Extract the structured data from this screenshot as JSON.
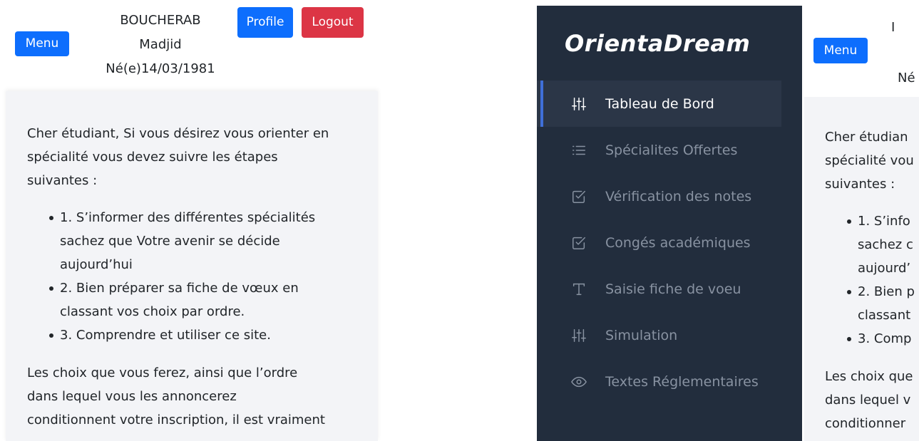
{
  "left": {
    "menu_label": "Menu",
    "profile_label": "Profile",
    "logout_label": "Logout",
    "user": {
      "last_name": "BOUCHERAB",
      "first_name": "Madjid",
      "birth": "Né(e)14/03/1981"
    },
    "intro_lines": [
      "Cher étudiant, Si vous désirez vous orienter en",
      "spécialité vous devez suivre les étapes",
      "suivantes :"
    ],
    "steps": [
      [
        "1. S’informer des différentes spécialités",
        "sachez que Votre avenir se décide",
        "aujourd’hui"
      ],
      [
        "2. Bien préparer sa fiche de vœux en",
        "classant vos choix par ordre."
      ],
      [
        "3. Comprendre et utiliser ce site."
      ]
    ],
    "closing_lines": [
      "Les choix que vous ferez, ainsi que l’ordre",
      "dans lequel vous les annoncerez",
      "conditionnent votre inscription, il est vraiment"
    ]
  },
  "right": {
    "brand": "OrientaDream",
    "nav": [
      {
        "label": "Tableau de Bord",
        "icon": "sliders-icon",
        "active": true
      },
      {
        "label": "Spécialites Offertes",
        "icon": "list-icon",
        "active": false
      },
      {
        "label": "Vérification des notes",
        "icon": "checkbox-icon",
        "active": false
      },
      {
        "label": "Congés académiques",
        "icon": "checkbox-icon",
        "active": false
      },
      {
        "label": "Saisie fiche de voeu",
        "icon": "text-icon",
        "active": false
      },
      {
        "label": "Simulation",
        "icon": "sliders-icon",
        "active": false
      },
      {
        "label": "Textes Réglementaires",
        "icon": "eye-icon",
        "active": false
      }
    ],
    "menu_label": "Menu",
    "user_top_fragment": "I",
    "birth_fragment": "Né",
    "intro_lines": [
      "Cher étudian",
      "spécialité vou",
      "suivantes :"
    ],
    "steps": [
      [
        "1. S’info",
        "sachez c",
        "aujourd’"
      ],
      [
        "2. Bien p",
        "classant"
      ],
      [
        "3. Comp"
      ]
    ],
    "closing_lines": [
      "Les choix que",
      "dans lequel v",
      "conditionner"
    ]
  },
  "colors": {
    "primary": "#0d6efd",
    "danger": "#dc3545",
    "sidebar_bg": "#222d3d",
    "sidebar_active_bg": "#2b3647",
    "sidebar_active_accent": "#3f6fd8",
    "content_bg": "#f3f4f7"
  }
}
